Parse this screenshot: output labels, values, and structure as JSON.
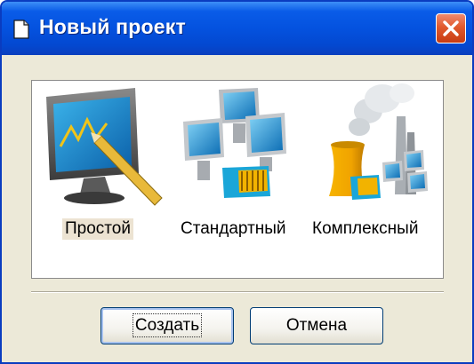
{
  "window": {
    "title": "Новый проект",
    "title_icon": "document-icon",
    "close_icon": "close-icon"
  },
  "project_types": [
    {
      "label": "Простой",
      "icon": "monitor-chart-pencil-icon",
      "selected": true
    },
    {
      "label": "Стандартный",
      "icon": "networked-computers-icon",
      "selected": false
    },
    {
      "label": "Комплексный",
      "icon": "industrial-plant-icon",
      "selected": false
    }
  ],
  "buttons": {
    "create_label": "Создать",
    "cancel_label": "Отмена"
  },
  "colors": {
    "titlebar": "#0452df",
    "close_button": "#e15a2e",
    "window_background": "#ece9d8",
    "selection_highlight": "#ece3d2"
  }
}
